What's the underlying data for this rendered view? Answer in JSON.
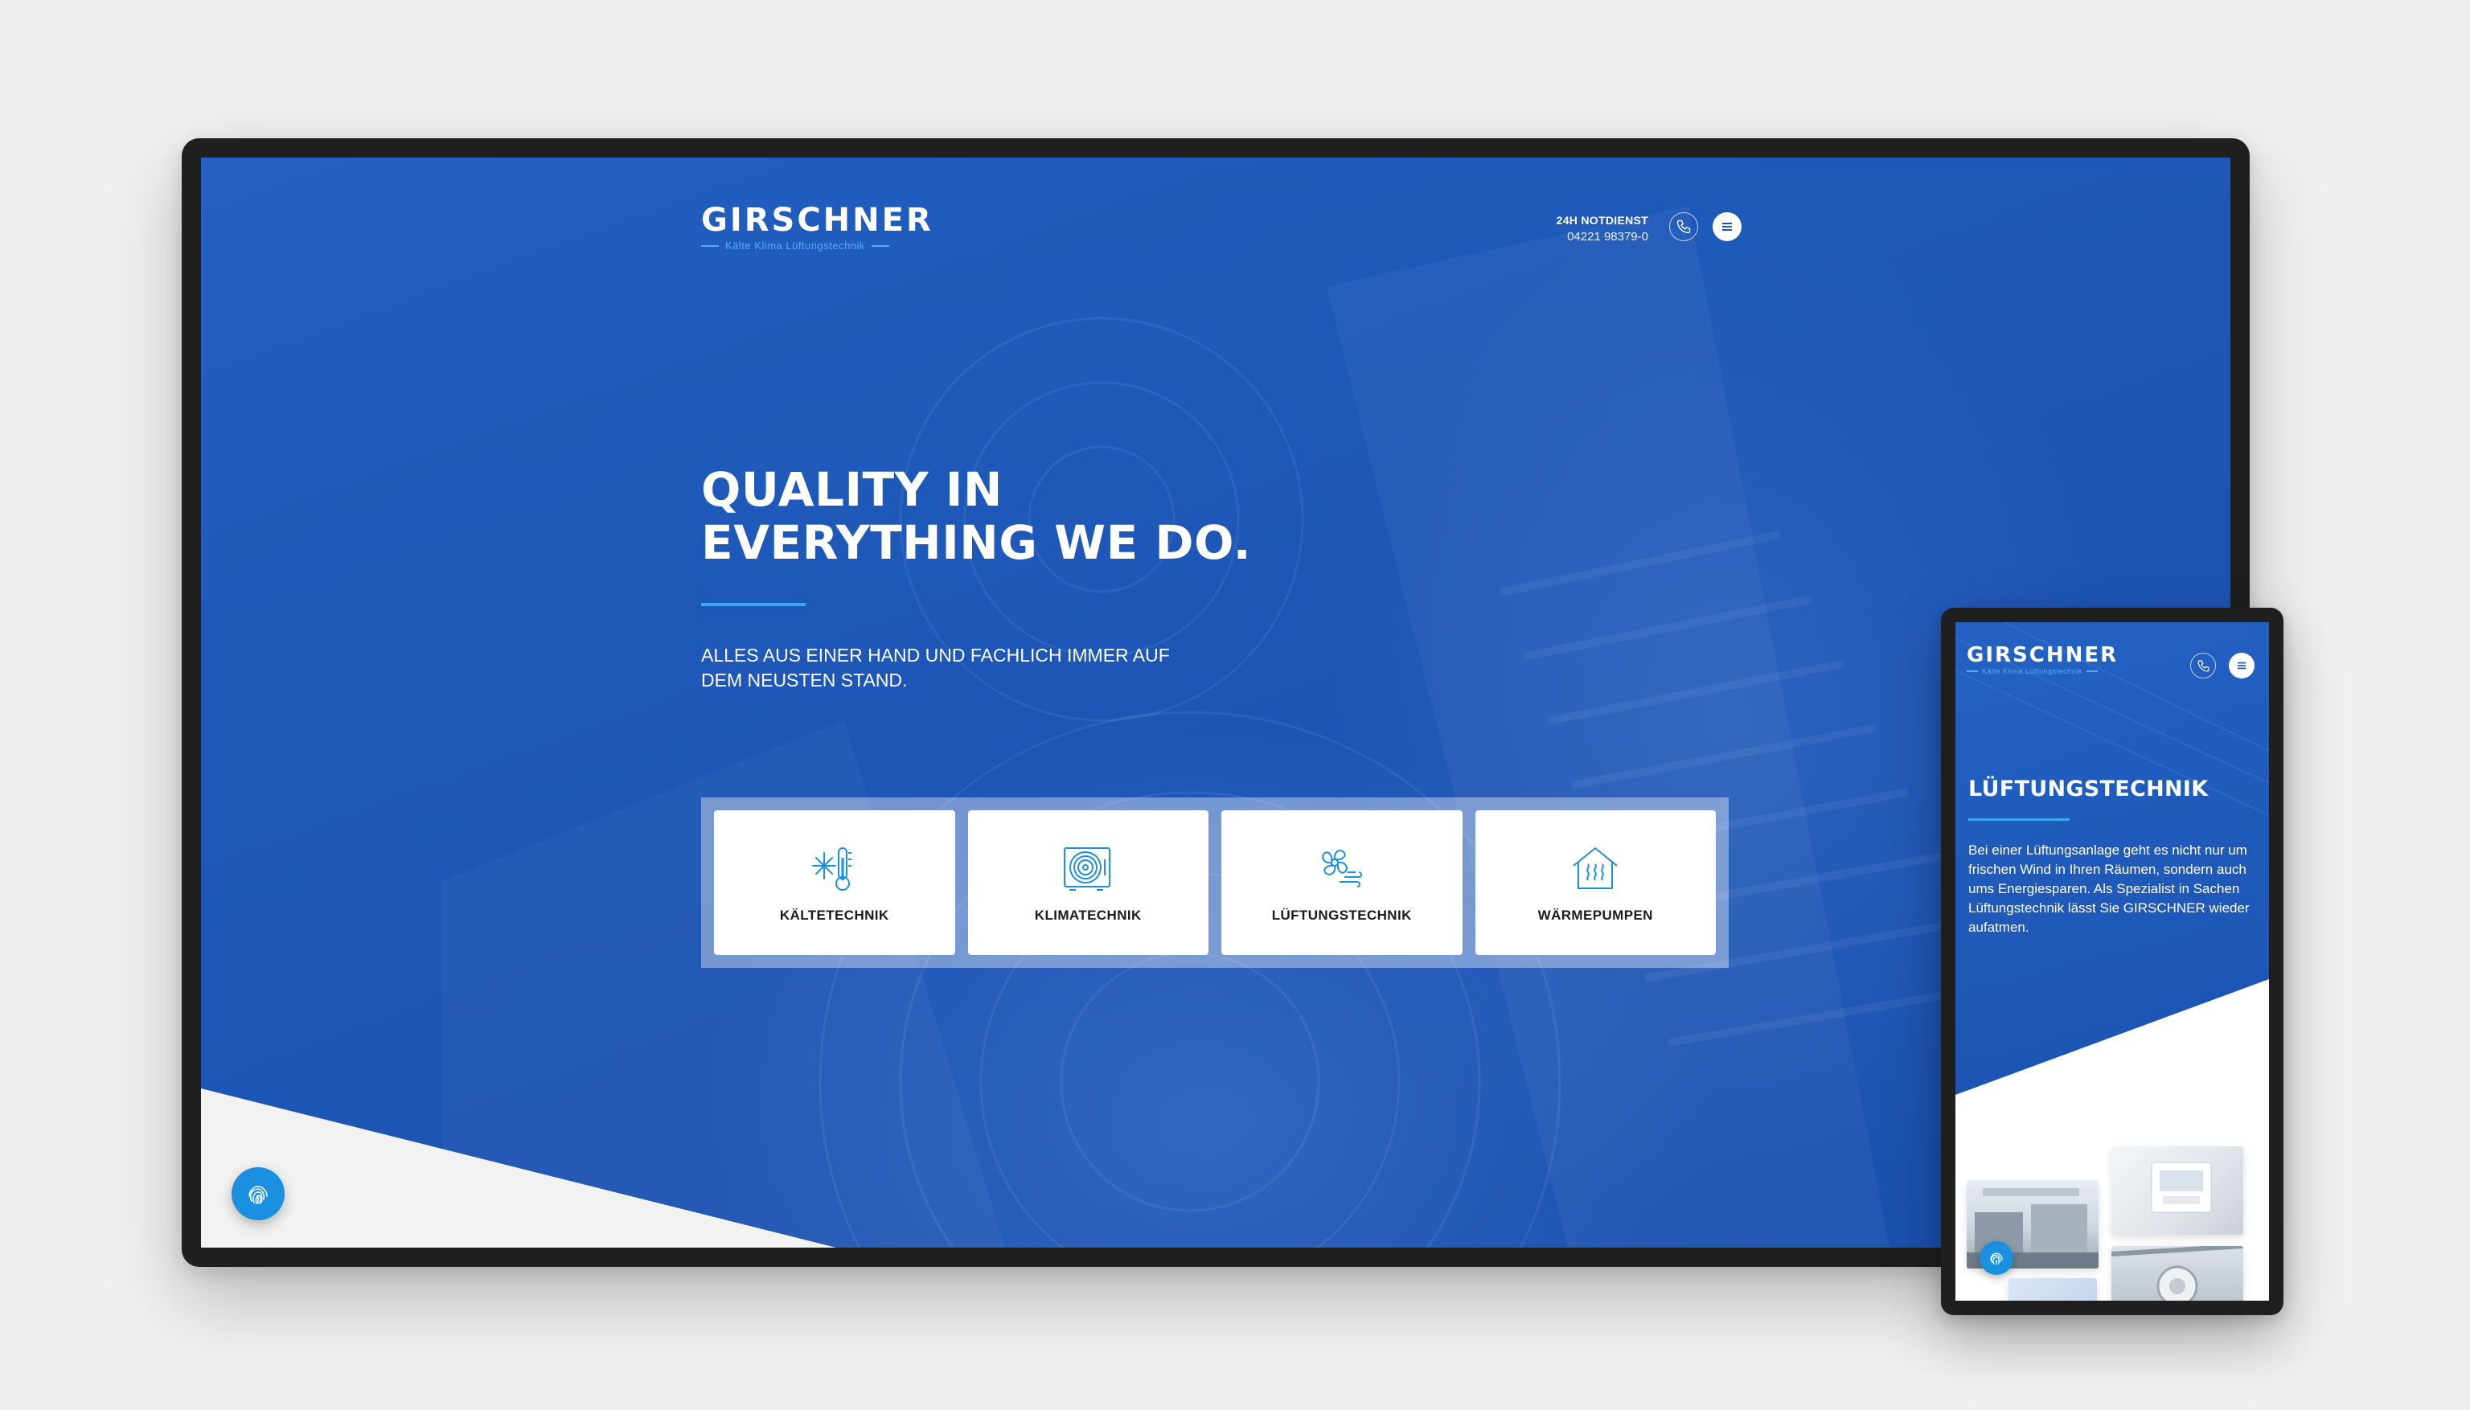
{
  "brand": {
    "name": "GIRSCHNER",
    "tagline": "Kälte  Klima  Lüftungstechnik",
    "accent_color": "#3ea8f2",
    "primary_color": "#1f57b9"
  },
  "desktop": {
    "header": {
      "emergency_label": "24H NOTDIENST",
      "emergency_phone": "04221 98379-0",
      "phone_icon": "phone-icon",
      "menu_icon": "hamburger-menu-icon"
    },
    "hero": {
      "headline_line1": "QUALITY IN",
      "headline_line2": "EVERYTHING WE DO.",
      "subline": "ALLES AUS EINER HAND UND FACHLICH IMMER AUF DEM NEUSTEN STAND."
    },
    "services": [
      {
        "label": "KÄLTETECHNIK",
        "icon": "thermometer-snowflake-icon"
      },
      {
        "label": "KLIMATECHNIK",
        "icon": "air-conditioner-unit-icon"
      },
      {
        "label": "LÜFTUNGSTECHNIK",
        "icon": "fan-airflow-icon"
      },
      {
        "label": "WÄRMEPUMPEN",
        "icon": "house-heat-icon"
      }
    ],
    "cookie_button_icon": "fingerprint-icon"
  },
  "tablet": {
    "title": "LÜFTUNGSTECHNIK",
    "text": "Bei einer Lüftungsanlage geht es nicht nur um frischen Wind in Ihren Räumen, sondern auch ums Energiesparen. Als Spezialist in Sachen Lüftungstechnik lässt Sie GIRSCHNER wieder aufatmen."
  }
}
